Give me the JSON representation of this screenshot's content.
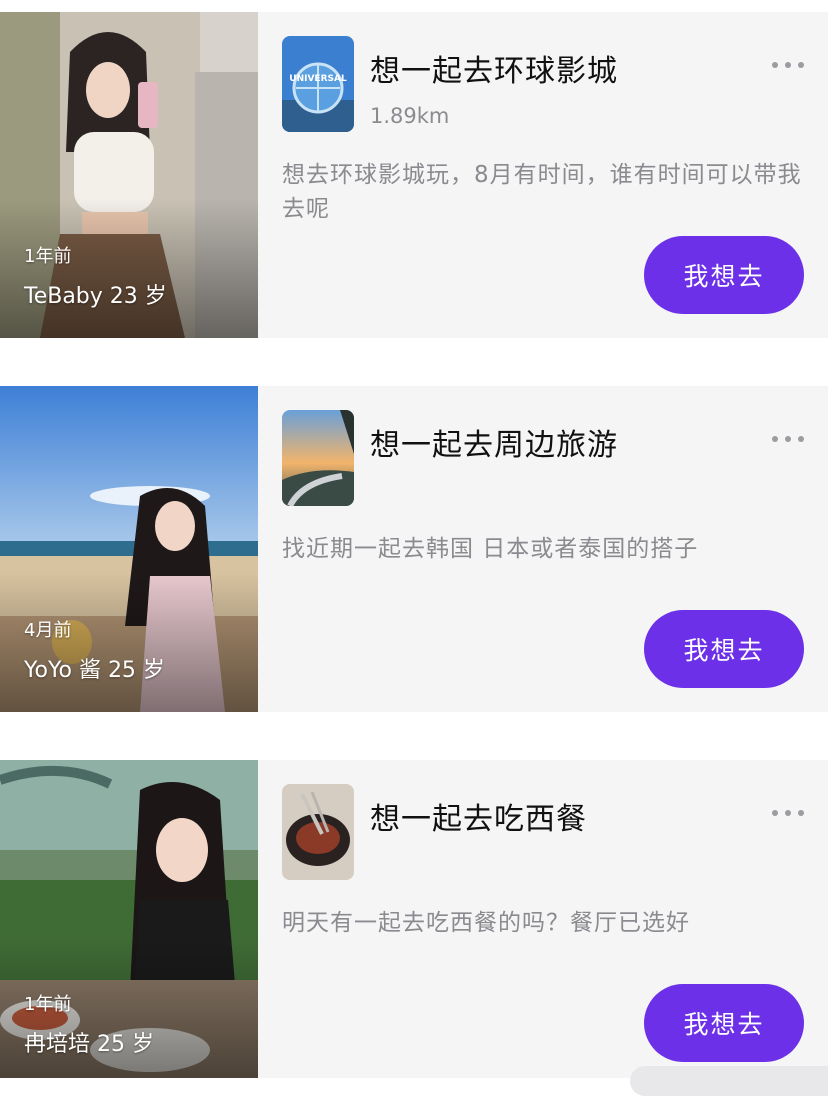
{
  "cards": [
    {
      "time": "1年前",
      "user": "TeBaby 23 岁",
      "title": "想一起去环球影城",
      "distance": "1.89km",
      "desc": "想去环球影城玩，8月有时间，谁有时间可以带我去呢",
      "button": "我想去",
      "thumb_text": "UNIVERSAL"
    },
    {
      "time": "4月前",
      "user": "YoYo 酱 25 岁",
      "title": "想一起去周边旅游",
      "distance": "",
      "desc": "找近期一起去韩国 日本或者泰国的搭子",
      "button": "我想去"
    },
    {
      "time": "1年前",
      "user": "冉培培 25 岁",
      "title": "想一起去吃西餐",
      "distance": "",
      "desc": "明天有一起去吃西餐的吗？餐厅已选好",
      "button": "我想去"
    }
  ],
  "colors": {
    "accent": "#6c30e8",
    "card_bg": "#f5f5f6",
    "secondary_text": "#8a8a8f"
  },
  "icons": [
    "more-icon"
  ]
}
